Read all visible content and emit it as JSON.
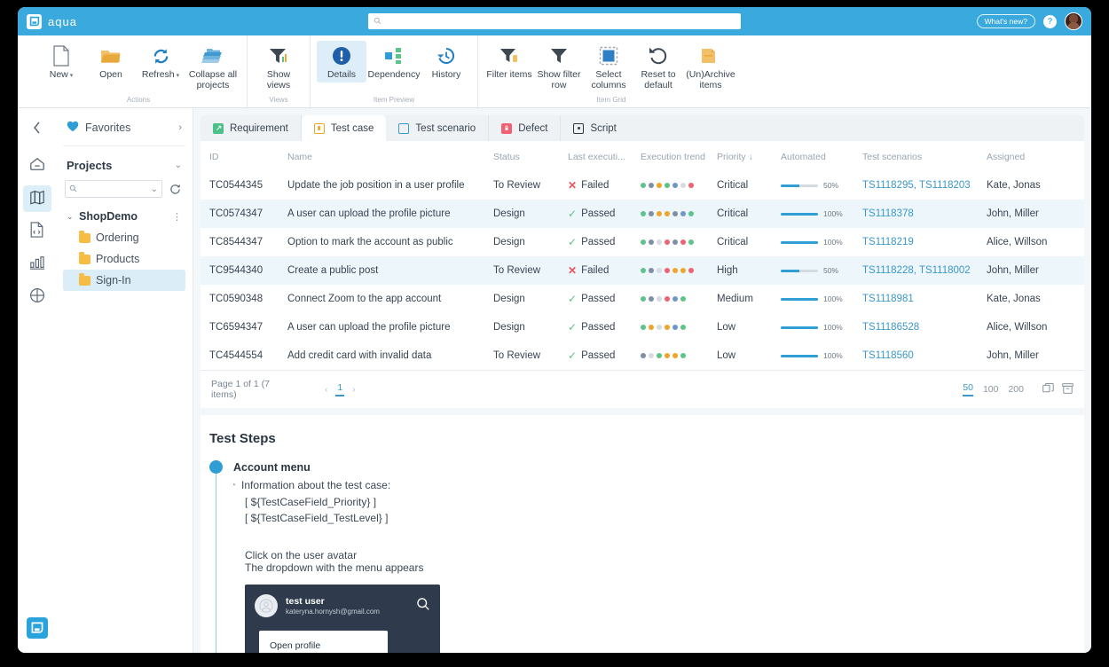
{
  "app": {
    "brand": "aqua",
    "brand_icon": "aqua-logo-icon"
  },
  "topbar": {
    "search_placeholder": "",
    "search_value": "",
    "search_icon": "search-icon",
    "whats_new": "What's new?",
    "help": "?",
    "avatar": "user-avatar"
  },
  "ribbon": {
    "groups": [
      {
        "label": "Actions",
        "buttons": [
          {
            "label": "New",
            "icon": "new-document-icon",
            "caret": true,
            "active": false
          },
          {
            "label": "Open",
            "icon": "open-folder-icon",
            "caret": false,
            "active": false
          },
          {
            "label": "Refresh",
            "icon": "refresh-icon",
            "caret": true,
            "active": false
          },
          {
            "label": "Collapse all projects",
            "icon": "collapse-projects-icon",
            "caret": false,
            "active": false
          }
        ]
      },
      {
        "label": "Views",
        "buttons": [
          {
            "label": "Show views",
            "icon": "show-views-icon",
            "caret": false,
            "active": false
          }
        ]
      },
      {
        "label": "Item Preview",
        "buttons": [
          {
            "label": "Details",
            "icon": "details-icon",
            "caret": false,
            "active": true
          },
          {
            "label": "Dependency",
            "icon": "dependency-icon",
            "caret": false,
            "active": false
          },
          {
            "label": "History",
            "icon": "history-icon",
            "caret": false,
            "active": false
          }
        ]
      },
      {
        "label": "Item Grid",
        "buttons": [
          {
            "label": "Filter items",
            "icon": "filter-items-icon",
            "caret": false,
            "active": false
          },
          {
            "label": "Show filter row",
            "icon": "show-filter-row-icon",
            "caret": false,
            "active": false
          },
          {
            "label": "Select columns",
            "icon": "select-columns-icon",
            "caret": false,
            "active": false
          },
          {
            "label": "Reset to default",
            "icon": "reset-to-default-icon",
            "caret": false,
            "active": false
          },
          {
            "label": "(Un)Archive items",
            "icon": "archive-items-icon",
            "caret": false,
            "active": false
          }
        ]
      }
    ]
  },
  "rail": {
    "collapse_icon": "chevron-left-icon",
    "items": [
      {
        "icon": "home-icon",
        "active": false
      },
      {
        "icon": "map-icon",
        "active": true
      },
      {
        "icon": "code-file-icon",
        "active": false
      },
      {
        "icon": "bar-chart-icon",
        "active": false
      },
      {
        "icon": "grid-plus-icon",
        "active": false
      }
    ],
    "bottom_icon": "aqua-chat-icon"
  },
  "sidebar": {
    "favorites_label": "Favorites",
    "favorites_icon": "heart-icon",
    "favorites_chevron": "chevron-right-icon",
    "projects_label": "Projects",
    "projects_chevron": "chevron-down-icon",
    "search_value": "",
    "search_placeholder": "",
    "search_icon": "search-icon",
    "refresh_icon": "refresh-icon",
    "tree": {
      "root": "ShopDemo",
      "root_chevron": "chevron-down-icon",
      "root_menu_icon": "more-vertical-icon",
      "children": [
        {
          "label": "Ordering",
          "selected": false,
          "icon": "folder-icon"
        },
        {
          "label": "Products",
          "selected": false,
          "icon": "folder-icon"
        },
        {
          "label": "Sign-In",
          "selected": true,
          "icon": "folder-icon"
        }
      ]
    }
  },
  "tabs": [
    {
      "label": "Requirement",
      "icon": "requirement-icon",
      "color": "#4cbf8b",
      "active": false
    },
    {
      "label": "Test case",
      "icon": "test-case-icon",
      "color": "#efa529",
      "active": true
    },
    {
      "label": "Test scenario",
      "icon": "test-scenario-icon",
      "color": "#3a97c9",
      "active": false
    },
    {
      "label": "Defect",
      "icon": "defect-icon",
      "color": "#ef6274",
      "active": false
    },
    {
      "label": "Script",
      "icon": "script-icon",
      "color": "#2b3642",
      "active": false
    }
  ],
  "grid": {
    "columns": [
      "ID",
      "Name",
      "Status",
      "Last executi...",
      "Execution trend",
      "Priority ↓",
      "Automated",
      "Test scenarios",
      "Assigned"
    ],
    "rows": [
      {
        "id": "TC0544345",
        "name": "Update the job position in a user profile",
        "status": "To Review",
        "last_execution": "Failed",
        "last_execution_state": "failed",
        "trend": [
          "#5cc389",
          "#7f8fa4",
          "#efa529",
          "#5cc389",
          "#6f97c4",
          "#d7dbe0",
          "#ef6274"
        ],
        "priority": "Critical",
        "automated_pct": 50,
        "automated_label": "50%",
        "scenarios": "TS1118295, TS1118203",
        "assigned": "Kate, Jonas",
        "highlight": false
      },
      {
        "id": "TC0574347",
        "name": "A user can upload the profile picture",
        "status": "Design",
        "last_execution": "Passed",
        "last_execution_state": "passed",
        "trend": [
          "#5cc389",
          "#7f8fa4",
          "#efa529",
          "#efa529",
          "#7f8fa4",
          "#6f97c4",
          "#5cc389"
        ],
        "priority": "Critical",
        "automated_pct": 100,
        "automated_label": "100%",
        "scenarios": "TS1118378",
        "assigned": "John, Miller",
        "highlight": true
      },
      {
        "id": "TC8544347",
        "name": "Option to mark the account as public",
        "status": "Design",
        "last_execution": "Passed",
        "last_execution_state": "passed",
        "trend": [
          "#5cc389",
          "#7f8fa4",
          "#d7dbe0",
          "#ef6274",
          "#7f8fa4",
          "#ef6274",
          "#5cc389"
        ],
        "priority": "Critical",
        "automated_pct": 100,
        "automated_label": "100%",
        "scenarios": "TS1118219",
        "assigned": "Alice, Willson",
        "highlight": false
      },
      {
        "id": "TC9544340",
        "name": "Create a public post",
        "status": "To Review",
        "last_execution": "Failed",
        "last_execution_state": "failed",
        "trend": [
          "#5cc389",
          "#7f8fa4",
          "#d7dbe0",
          "#ef6274",
          "#efa529",
          "#efa529",
          "#ef6274"
        ],
        "priority": "High",
        "automated_pct": 50,
        "automated_label": "50%",
        "scenarios": "TS1118228, TS1118002",
        "assigned": "John, Miller",
        "highlight": true
      },
      {
        "id": "TC0590348",
        "name": "Connect Zoom to the app account",
        "status": "Design",
        "last_execution": "Passed",
        "last_execution_state": "passed",
        "trend": [
          "#5cc389",
          "#7f8fa4",
          "#d7dbe0",
          "#ef6274",
          "#6f97c4",
          "#5cc389"
        ],
        "priority": "Medium",
        "automated_pct": 100,
        "automated_label": "100%",
        "scenarios": "TS1118981",
        "assigned": "Kate, Jonas",
        "highlight": false
      },
      {
        "id": "TC6594347",
        "name": "A user can upload the profile picture",
        "status": "Design",
        "last_execution": "Passed",
        "last_execution_state": "passed",
        "trend": [
          "#5cc389",
          "#efa529",
          "#d7dbe0",
          "#efa529",
          "#6f97c4",
          "#5cc389"
        ],
        "priority": "Low",
        "automated_pct": 100,
        "automated_label": "100%",
        "scenarios": "TS11186528",
        "assigned": "Alice, Willson",
        "highlight": false
      },
      {
        "id": "TC4544554",
        "name": "Add credit card with invalid data",
        "status": "To Review",
        "last_execution": "Passed",
        "last_execution_state": "passed",
        "trend": [
          "#7f8fa4",
          "#d7dbe0",
          "#5cc389",
          "#efa529",
          "#efa529",
          "#5cc389"
        ],
        "priority": "Low",
        "automated_pct": 100,
        "automated_label": "100%",
        "scenarios": "TS1118560",
        "assigned": "John, Miller",
        "highlight": false
      }
    ]
  },
  "pager": {
    "summary": "Page 1 of 1 (7 items)",
    "prev_icon": "chevron-left-icon",
    "next_icon": "chevron-right-icon",
    "current_page": "1",
    "page_sizes": [
      "50",
      "100",
      "200"
    ],
    "active_page_size": "50",
    "copy_icon": "copy-icon",
    "archive_icon": "archive-icon"
  },
  "test_steps": {
    "title": "Test Steps",
    "step_name": "Account menu",
    "info_icon": "note-icon",
    "info_text": "Information about the test case:",
    "variables": [
      "[ ${TestCaseField_Priority} ]",
      "[ ${TestCaseField_TestLevel} ]"
    ],
    "lines": [
      "Click on the user avatar",
      "The dropdown with the menu appears"
    ],
    "screenshot": {
      "user_name": "test user",
      "user_email": "kateryna.hornysh@gmail.com",
      "search_icon": "search-icon",
      "avatar_icon": "avatar-icon",
      "menu_item": "Open profile"
    }
  },
  "colors": {
    "accent": "#3aa9dd",
    "link": "#3a97c9",
    "passed": "#5cc389",
    "failed": "#e8555e",
    "highlight_row": "#edf6fb"
  }
}
